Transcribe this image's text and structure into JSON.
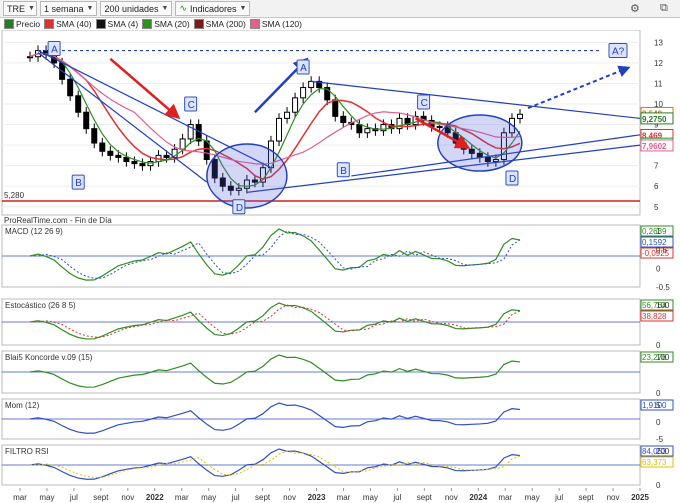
{
  "toolbar": {
    "symbol": "TRE",
    "period": "1 semana",
    "units": "200 unidades",
    "indicators_label": "Indicadores"
  },
  "legend": [
    {
      "label": "Precio",
      "color": "#2a7a2a"
    },
    {
      "label": "SMA (40)",
      "color": "#e03030"
    },
    {
      "label": "SMA (4)",
      "color": "#111111"
    },
    {
      "label": "SMA (20)",
      "color": "#2f8f1f"
    },
    {
      "label": "SMA (200)",
      "color": "#7a1a1a"
    },
    {
      "label": "SMA (120)",
      "color": "#e06090"
    }
  ],
  "source_text": "ProRealTime.com - Fin de Día",
  "support_label": "5,280",
  "chart_data": {
    "type": "line",
    "x_labels": [
      "mar",
      "may",
      "jul",
      "sept",
      "nov",
      "2022",
      "mar",
      "may",
      "jul",
      "sept",
      "nov",
      "2023",
      "mar",
      "may",
      "jul",
      "sept",
      "nov",
      "2024",
      "mar",
      "may",
      "jul",
      "sept",
      "nov",
      "2025"
    ],
    "price_axis": {
      "ylim": [
        4.6,
        13.6
      ],
      "ticks": [
        "13",
        "12",
        "11",
        "10",
        "9",
        "8",
        "7",
        "6",
        "5"
      ]
    },
    "price_labels": [
      {
        "text": "9,540",
        "color": "#e07800",
        "value": 9.54
      },
      {
        "text": "9,2750",
        "color": "#2a7a2a",
        "value": 9.275
      },
      {
        "text": "8,469",
        "color": "#e03030",
        "value": 8.469
      },
      {
        "text": "8,0463",
        "color": "#2f8f1f",
        "value": 8.046
      },
      {
        "text": "7,9602",
        "color": "#e06090",
        "value": 7.96
      }
    ],
    "annotations": [
      "A",
      "B",
      "C",
      "D",
      "A",
      "B",
      "C",
      "D",
      "A?"
    ],
    "price_series": [
      12.3,
      12.6,
      12.4,
      12.0,
      11.2,
      10.4,
      9.6,
      8.8,
      8.1,
      7.7,
      7.5,
      7.4,
      7.2,
      7.1,
      7.0,
      7.2,
      7.5,
      7.4,
      7.8,
      8.3,
      9.0,
      8.2,
      7.3,
      6.4,
      6.0,
      5.8,
      5.9,
      6.3,
      6.2,
      6.9,
      8.2,
      9.3,
      9.6,
      10.3,
      10.8,
      11.1,
      10.8,
      10.2,
      9.4,
      9.1,
      9.0,
      8.6,
      8.8,
      8.7,
      9.0,
      8.8,
      9.3,
      9.0,
      9.4,
      9.2,
      8.9,
      8.9,
      8.6,
      8.1,
      7.8,
      7.6,
      7.4,
      7.2,
      7.3,
      8.6,
      9.3,
      9.5
    ],
    "indicators": [
      {
        "name": "MACD (12 26 9)",
        "values": [
          "0,2639",
          "0,1592",
          "-0,0925"
        ],
        "colors": [
          "#2f8f1f",
          "#3050c0",
          "#e03030"
        ],
        "ticks": [
          "1",
          "0.5",
          "0",
          "-0.5"
        ]
      },
      {
        "name": "Estocástico (26 8 5)",
        "values": [
          "56,764",
          "38,828"
        ],
        "colors": [
          "#2f8f1f",
          "#e03030"
        ],
        "ticks": [
          "100",
          "0"
        ]
      },
      {
        "name": "Blai5 Koncorde v.09 (15)",
        "values": [
          "23,276"
        ],
        "colors": [
          "#2f8f1f"
        ],
        "ticks": [
          "100",
          "0"
        ]
      },
      {
        "name": "Mom (12)",
        "values": [
          "1,9100"
        ],
        "colors": [
          "#3050c0"
        ],
        "ticks": [
          "5",
          "0",
          "-5"
        ]
      },
      {
        "name": "FILTRO RSI",
        "values": [
          "84,053",
          "63,373"
        ],
        "colors": [
          "#3050c0",
          "#e0c000"
        ],
        "ticks": [
          "200",
          "0"
        ]
      }
    ]
  }
}
